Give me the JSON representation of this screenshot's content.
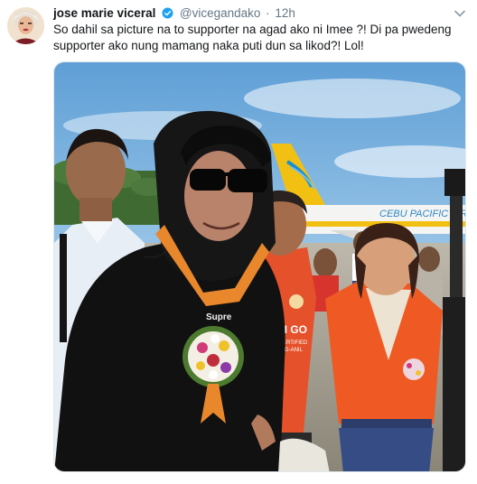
{
  "tweet": {
    "display_name": "jose marie viceral",
    "handle": "@vicegandako",
    "separator": "·",
    "time": "12h",
    "text": "So dahil sa picture na to supporter na agad ako ni Imee ?! Di pa pwedeng\nsupporter ako nung mamang naka puti dun sa likod?! Lol!",
    "verified": true
  },
  "photo": {
    "airline_text": "CEBU PACIFIC AIR",
    "shirt_text_1": "GOI GO",
    "shirt_text_2": "DO CERTIFIED",
    "shirt_text_3": "SA PAG-ANIL",
    "lanyard_text": "Supre",
    "colors": {
      "sky": "#8fc3e6",
      "plane_tail": "#f2c012",
      "jacket": "#ef5a24",
      "hoodie": "#111111",
      "garland": "#e8872c"
    }
  },
  "icons": {
    "verified": "verified-badge-icon",
    "caret": "chevron-down-icon"
  }
}
